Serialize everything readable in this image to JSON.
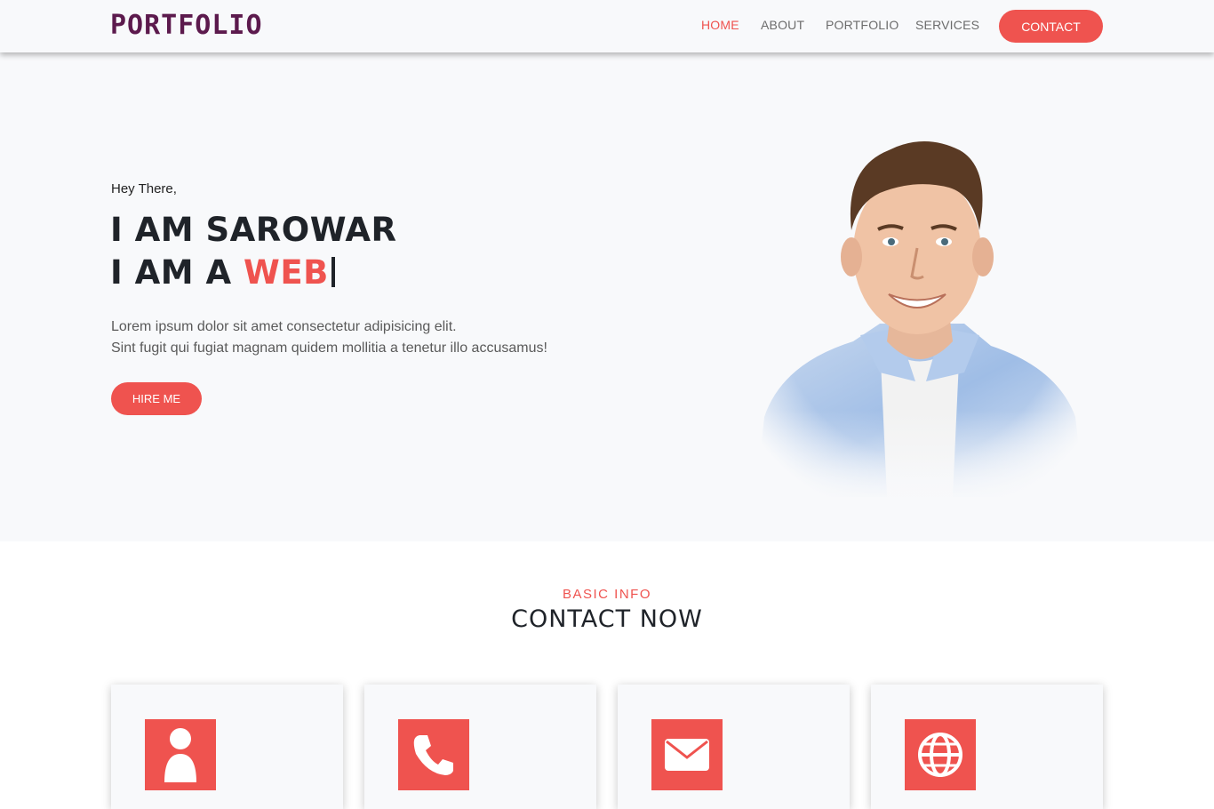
{
  "brand": {
    "logo_text": "PORTFOLIO"
  },
  "nav": {
    "items": [
      {
        "label": "HOME",
        "active": true
      },
      {
        "label": "ABOUT",
        "active": false
      },
      {
        "label": "PORTFOLIO",
        "active": false
      },
      {
        "label": "SERVICES",
        "active": false
      }
    ],
    "cta_label": "CONTACT"
  },
  "hero": {
    "greeting": "Hey There,",
    "line1": "I AM SAROWAR",
    "line2_prefix": "I AM A ",
    "line2_accent": "WEB",
    "description_line1": "Lorem ipsum dolor sit amet consectetur adipisicing elit.",
    "description_line2": "Sint fugit qui fugiat magnam quidem mollitia a tenetur illo accusamus!",
    "button_label": "HIRE ME"
  },
  "contact": {
    "kicker": "BASIC INFO",
    "title": "CONTACT NOW",
    "cards": [
      {
        "icon": "user-icon"
      },
      {
        "icon": "phone-icon"
      },
      {
        "icon": "envelope-icon"
      },
      {
        "icon": "globe-icon"
      }
    ]
  },
  "colors": {
    "accent": "#ef534f",
    "dark": "#1f2329",
    "hero_bg": "#f8f9fb"
  }
}
